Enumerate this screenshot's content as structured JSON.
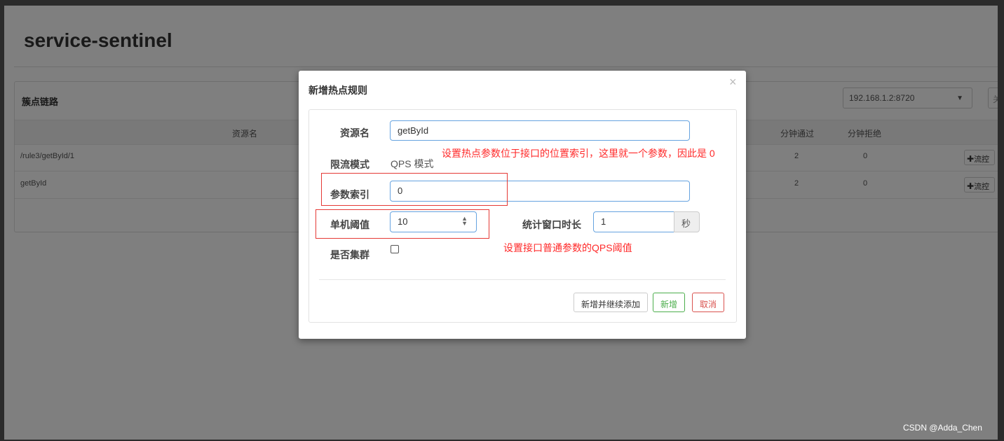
{
  "app": {
    "title": "service-sentinel"
  },
  "panel": {
    "title": "簇点链路",
    "machine_select": "192.168.1.2:8720",
    "edge_button": "关"
  },
  "table": {
    "headers": {
      "resource": "资源名",
      "pass_qps": "分钟通过",
      "block_qps": "分钟拒绝"
    },
    "rows": [
      {
        "resource": "/rule3/getById/1",
        "pass": "2",
        "block": "0",
        "action": "流控"
      },
      {
        "resource": "getById",
        "pass": "2",
        "block": "0",
        "action": "流控"
      }
    ]
  },
  "modal": {
    "title": "新增热点规则",
    "close": "×",
    "fields": {
      "resource_label": "资源名",
      "resource_value": "getById",
      "mode_label": "限流模式",
      "mode_value": "QPS 模式",
      "param_index_label": "参数索引",
      "param_index_value": "0",
      "threshold_label": "单机阈值",
      "threshold_value": "10",
      "window_label": "统计窗口时长",
      "window_value": "1",
      "window_unit": "秒",
      "cluster_label": "是否集群"
    },
    "buttons": {
      "add_continue": "新增并继续添加",
      "add": "新增",
      "cancel": "取消"
    }
  },
  "annotations": {
    "param_index_note": "设置热点参数位于接口的位置索引，这里就一个参数，因此是 0",
    "threshold_note": "设置接口普通参数的QPS阈值"
  },
  "watermark": "CSDN @Adda_Chen",
  "colors": {
    "annotation": "#ff2a2a",
    "add_button": "#4cae4c",
    "cancel_button": "#d9534f",
    "input_border": "#66a3e0"
  }
}
